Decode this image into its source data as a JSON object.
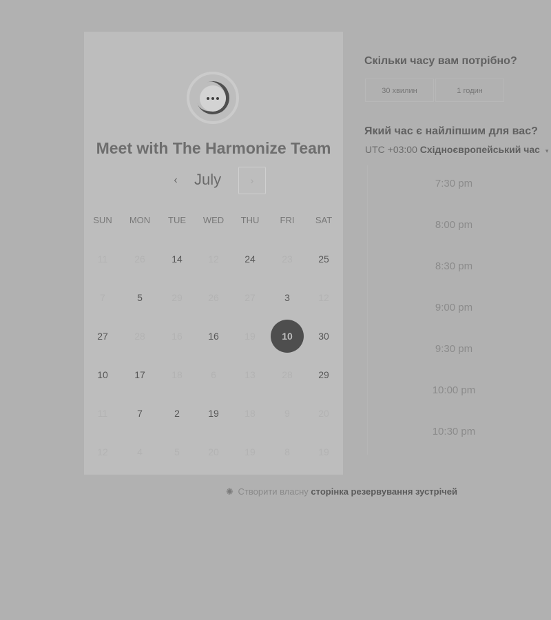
{
  "card": {
    "title": "Meet with The Harmonize Team",
    "month": "July",
    "prev_icon": "‹",
    "next_icon": "›",
    "weekdays": [
      "SUN",
      "MON",
      "TUE",
      "WED",
      "THU",
      "FRI",
      "SAT"
    ],
    "days": [
      [
        {
          "label": "11",
          "available": false
        },
        {
          "label": "26",
          "available": false
        },
        {
          "label": "14",
          "available": true
        },
        {
          "label": "12",
          "available": false
        },
        {
          "label": "24",
          "available": true
        },
        {
          "label": "23",
          "available": false
        },
        {
          "label": "25",
          "available": true
        }
      ],
      [
        {
          "label": "7",
          "available": false
        },
        {
          "label": "5",
          "available": true
        },
        {
          "label": "29",
          "available": false
        },
        {
          "label": "26",
          "available": false
        },
        {
          "label": "27",
          "available": false
        },
        {
          "label": "3",
          "available": true
        },
        {
          "label": "12",
          "available": false
        }
      ],
      [
        {
          "label": "27",
          "available": true
        },
        {
          "label": "28",
          "available": false
        },
        {
          "label": "16",
          "available": false
        },
        {
          "label": "16",
          "available": true
        },
        {
          "label": "19",
          "available": false
        },
        {
          "label": "10",
          "available": true,
          "selected": true
        },
        {
          "label": "30",
          "available": true
        }
      ],
      [
        {
          "label": "10",
          "available": true
        },
        {
          "label": "17",
          "available": true
        },
        {
          "label": "18",
          "available": false
        },
        {
          "label": "6",
          "available": false
        },
        {
          "label": "13",
          "available": false
        },
        {
          "label": "28",
          "available": false
        },
        {
          "label": "29",
          "available": true
        }
      ],
      [
        {
          "label": "11",
          "available": false
        },
        {
          "label": "7",
          "available": true
        },
        {
          "label": "2",
          "available": true
        },
        {
          "label": "19",
          "available": true
        },
        {
          "label": "18",
          "available": false
        },
        {
          "label": "9",
          "available": false
        },
        {
          "label": "20",
          "available": false
        }
      ],
      [
        {
          "label": "12",
          "available": false
        },
        {
          "label": "4",
          "available": false
        },
        {
          "label": "5",
          "available": false
        },
        {
          "label": "20",
          "available": false
        },
        {
          "label": "19",
          "available": false
        },
        {
          "label": "8",
          "available": false
        },
        {
          "label": "19",
          "available": false
        }
      ]
    ]
  },
  "duration": {
    "question": "Скільки часу вам потрібно?",
    "options": [
      "30 хвилин",
      "1 годин"
    ]
  },
  "time": {
    "question": "Який час є найліпшим для вас?",
    "timezone_prefix": "UTC +03:00",
    "timezone_name": "Східноєвропейський час",
    "caret": "▾",
    "slots": [
      "7:30 pm",
      "8:00 pm",
      "8:30 pm",
      "9:00 pm",
      "9:30 pm",
      "10:00 pm",
      "10:30 pm"
    ]
  },
  "footer": {
    "icon": "✺",
    "prefix": "Створити власну",
    "link": "сторінка резервування зустрічей"
  },
  "colors": {
    "overlay_bg": "#b1b1b1",
    "card_bg": "#bdbdbd",
    "selected_day": "#4e4e4e"
  }
}
